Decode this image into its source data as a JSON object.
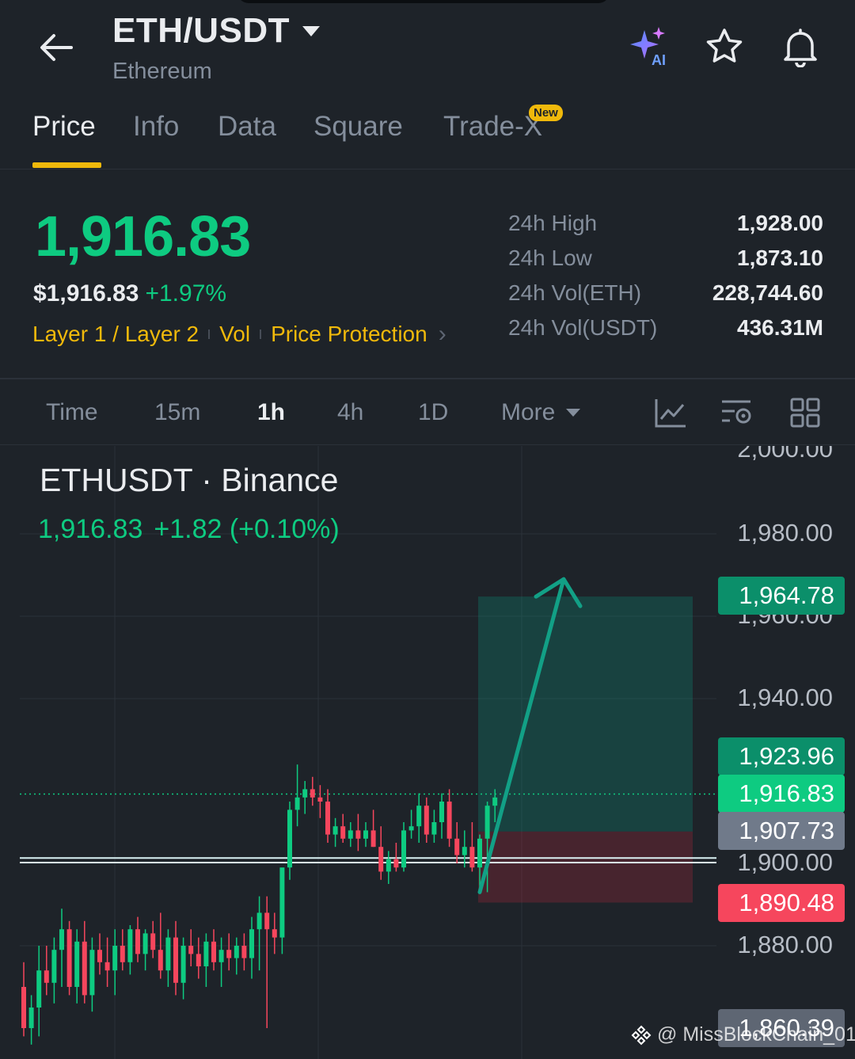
{
  "header": {
    "pair": "ETH/USDT",
    "subtitle": "Ethereum",
    "icons": [
      "back-arrow-icon",
      "ai-sparkle-icon",
      "star-icon",
      "bell-icon"
    ],
    "ai_label": "AI"
  },
  "tabs": [
    {
      "label": "Price",
      "active": true
    },
    {
      "label": "Info"
    },
    {
      "label": "Data"
    },
    {
      "label": "Square"
    },
    {
      "label": "Trade-X",
      "badge": "New"
    }
  ],
  "price": {
    "last": "1,916.83",
    "fiat": "$1,916.83",
    "change_pct": "+1.97%",
    "tags": [
      "Layer 1 / Layer 2",
      "Vol",
      "Price Protection"
    ]
  },
  "stats": [
    {
      "label": "24h High",
      "value": "1,928.00"
    },
    {
      "label": "24h Low",
      "value": "1,873.10"
    },
    {
      "label": "24h Vol(ETH)",
      "value": "228,744.60"
    },
    {
      "label": "24h Vol(USDT)",
      "value": "436.31M"
    }
  ],
  "intervals": {
    "items": [
      "Time",
      "15m",
      "1h",
      "4h",
      "1D"
    ],
    "active": "1h",
    "more_label": "More",
    "tool_icons": [
      "indicator-chart-icon",
      "chart-settings-icon",
      "layout-grid-icon"
    ]
  },
  "chart": {
    "title": "ETHUSDT · Binance",
    "quote_price": "1,916.83",
    "quote_change": "+1.82 (+0.10%)",
    "y_labels": [
      "2,000.00",
      "1,980.00",
      "1,960.00",
      "1,940.00",
      "1,900.00",
      "1,880.00"
    ],
    "price_badges": [
      {
        "label": "1,964.78",
        "color": "#0b8f6a"
      },
      {
        "label": "1,923.96",
        "color": "#0b8f6a"
      },
      {
        "label": "1,916.83",
        "color": "#0ecb81"
      },
      {
        "label": "1,907.73",
        "color": "#707a8a"
      },
      {
        "label": "1,890.48",
        "color": "#f6465d"
      },
      {
        "label": "1,860.39",
        "color": "#5e6673"
      }
    ],
    "colors": {
      "up": "#0ecb81",
      "down": "#f6465d",
      "arrow": "#12a086"
    },
    "watermark": "@ MissBlockChain_01"
  },
  "chart_data": {
    "type": "candlestick",
    "interval": "1h",
    "ylim": [
      1857,
      2002
    ],
    "y_ticks": [
      1880,
      1900,
      1940,
      1980,
      2000
    ],
    "candles": [
      {
        "o": 1870,
        "h": 1876,
        "l": 1858,
        "c": 1860
      },
      {
        "o": 1860,
        "h": 1868,
        "l": 1856,
        "c": 1865
      },
      {
        "o": 1865,
        "h": 1880,
        "l": 1858,
        "c": 1874
      },
      {
        "o": 1874,
        "h": 1880,
        "l": 1868,
        "c": 1871
      },
      {
        "o": 1871,
        "h": 1882,
        "l": 1866,
        "c": 1879
      },
      {
        "o": 1879,
        "h": 1889,
        "l": 1870,
        "c": 1884
      },
      {
        "o": 1884,
        "h": 1886,
        "l": 1868,
        "c": 1870
      },
      {
        "o": 1870,
        "h": 1884,
        "l": 1866,
        "c": 1881
      },
      {
        "o": 1881,
        "h": 1886,
        "l": 1866,
        "c": 1868
      },
      {
        "o": 1868,
        "h": 1882,
        "l": 1864,
        "c": 1879
      },
      {
        "o": 1879,
        "h": 1883,
        "l": 1873,
        "c": 1876
      },
      {
        "o": 1876,
        "h": 1882,
        "l": 1870,
        "c": 1874
      },
      {
        "o": 1874,
        "h": 1884,
        "l": 1868,
        "c": 1880
      },
      {
        "o": 1880,
        "h": 1884,
        "l": 1874,
        "c": 1876
      },
      {
        "o": 1876,
        "h": 1885,
        "l": 1873,
        "c": 1884
      },
      {
        "o": 1884,
        "h": 1887,
        "l": 1876,
        "c": 1878
      },
      {
        "o": 1878,
        "h": 1884,
        "l": 1874,
        "c": 1883
      },
      {
        "o": 1883,
        "h": 1886,
        "l": 1877,
        "c": 1879
      },
      {
        "o": 1879,
        "h": 1888,
        "l": 1872,
        "c": 1874
      },
      {
        "o": 1874,
        "h": 1884,
        "l": 1870,
        "c": 1882
      },
      {
        "o": 1882,
        "h": 1886,
        "l": 1868,
        "c": 1871
      },
      {
        "o": 1871,
        "h": 1882,
        "l": 1867,
        "c": 1880
      },
      {
        "o": 1880,
        "h": 1884,
        "l": 1875,
        "c": 1878
      },
      {
        "o": 1878,
        "h": 1882,
        "l": 1872,
        "c": 1875
      },
      {
        "o": 1875,
        "h": 1883,
        "l": 1870,
        "c": 1881
      },
      {
        "o": 1881,
        "h": 1884,
        "l": 1874,
        "c": 1876
      },
      {
        "o": 1876,
        "h": 1882,
        "l": 1870,
        "c": 1879
      },
      {
        "o": 1879,
        "h": 1883,
        "l": 1874,
        "c": 1877
      },
      {
        "o": 1877,
        "h": 1882,
        "l": 1873,
        "c": 1880
      },
      {
        "o": 1880,
        "h": 1883,
        "l": 1874,
        "c": 1877
      },
      {
        "o": 1877,
        "h": 1887,
        "l": 1872,
        "c": 1884
      },
      {
        "o": 1884,
        "h": 1892,
        "l": 1874,
        "c": 1888
      },
      {
        "o": 1888,
        "h": 1892,
        "l": 1860,
        "c": 1884
      },
      {
        "o": 1884,
        "h": 1888,
        "l": 1878,
        "c": 1882
      },
      {
        "o": 1882,
        "h": 1896,
        "l": 1878,
        "c": 1899
      },
      {
        "o": 1899,
        "h": 1915,
        "l": 1896,
        "c": 1913
      },
      {
        "o": 1913,
        "h": 1924,
        "l": 1909,
        "c": 1916
      },
      {
        "o": 1916,
        "h": 1920,
        "l": 1912,
        "c": 1918
      },
      {
        "o": 1918,
        "h": 1921,
        "l": 1914,
        "c": 1916
      },
      {
        "o": 1916,
        "h": 1919,
        "l": 1911,
        "c": 1915
      },
      {
        "o": 1915,
        "h": 1918,
        "l": 1905,
        "c": 1907
      },
      {
        "o": 1907,
        "h": 1911,
        "l": 1904,
        "c": 1909
      },
      {
        "o": 1909,
        "h": 1912,
        "l": 1905,
        "c": 1906
      },
      {
        "o": 1906,
        "h": 1910,
        "l": 1904,
        "c": 1908
      },
      {
        "o": 1908,
        "h": 1912,
        "l": 1903,
        "c": 1906
      },
      {
        "o": 1906,
        "h": 1910,
        "l": 1904,
        "c": 1908
      },
      {
        "o": 1908,
        "h": 1913,
        "l": 1904,
        "c": 1904
      },
      {
        "o": 1904,
        "h": 1909,
        "l": 1896,
        "c": 1898
      },
      {
        "o": 1898,
        "h": 1903,
        "l": 1895,
        "c": 1901
      },
      {
        "o": 1901,
        "h": 1905,
        "l": 1898,
        "c": 1899
      },
      {
        "o": 1899,
        "h": 1910,
        "l": 1898,
        "c": 1908
      },
      {
        "o": 1908,
        "h": 1913,
        "l": 1906,
        "c": 1909
      },
      {
        "o": 1909,
        "h": 1917,
        "l": 1905,
        "c": 1914
      },
      {
        "o": 1914,
        "h": 1916,
        "l": 1905,
        "c": 1907
      },
      {
        "o": 1907,
        "h": 1913,
        "l": 1905,
        "c": 1910
      },
      {
        "o": 1910,
        "h": 1917,
        "l": 1906,
        "c": 1915
      },
      {
        "o": 1915,
        "h": 1918,
        "l": 1904,
        "c": 1906
      },
      {
        "o": 1906,
        "h": 1910,
        "l": 1900,
        "c": 1902
      },
      {
        "o": 1902,
        "h": 1908,
        "l": 1899,
        "c": 1904
      },
      {
        "o": 1904,
        "h": 1910,
        "l": 1898,
        "c": 1899
      },
      {
        "o": 1899,
        "h": 1907,
        "l": 1894,
        "c": 1906
      },
      {
        "o": 1906,
        "h": 1915,
        "l": 1893,
        "c": 1914
      },
      {
        "o": 1914,
        "h": 1918,
        "l": 1910,
        "c": 1916
      }
    ],
    "position": {
      "entry": 1907.73,
      "take_profit": 1964.78,
      "stop_loss": 1890.48,
      "take_profit_2": 1923.96
    },
    "support_lines": [
      1901.3,
      1900.2
    ],
    "last_price": 1916.83
  }
}
